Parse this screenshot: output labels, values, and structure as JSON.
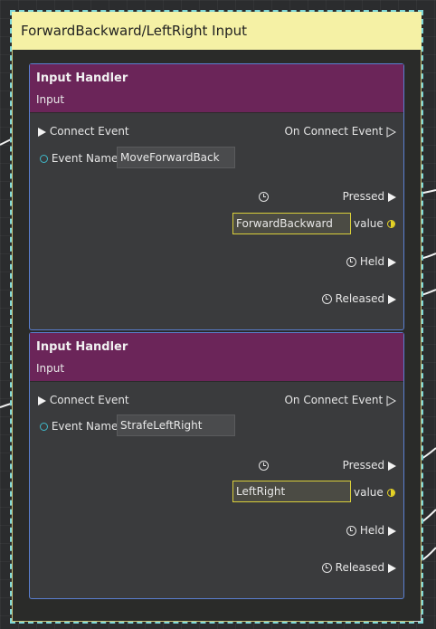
{
  "comment": {
    "title": "ForwardBackward/LeftRight Input"
  },
  "nodes": [
    {
      "title": "Input Handler",
      "subtitle": "Input",
      "connect_event": "Connect Event",
      "on_connect_event": "On Connect Event",
      "event_name_label": "Event Name",
      "event_name_value": "MoveForwardBack",
      "pressed": "Pressed",
      "value_field": "ForwardBackward",
      "value_label": "value",
      "held": "Held",
      "released": "Released"
    },
    {
      "title": "Input Handler",
      "subtitle": "Input",
      "connect_event": "Connect Event",
      "on_connect_event": "On Connect Event",
      "event_name_label": "Event Name",
      "event_name_value": "StrafeLeftRight",
      "pressed": "Pressed",
      "value_field": "LeftRight",
      "value_label": "value",
      "held": "Held",
      "released": "Released"
    }
  ],
  "colors": {
    "node_header": "#6b2559",
    "comment_header": "#f5f1a5",
    "selection_outline": "#5a7fd0",
    "value_pin": "#e6d325",
    "data_pin": "#3fb8c9"
  },
  "icons": [
    "exec-pin-icon",
    "data-pin-icon",
    "clock-icon",
    "value-pin-icon"
  ]
}
